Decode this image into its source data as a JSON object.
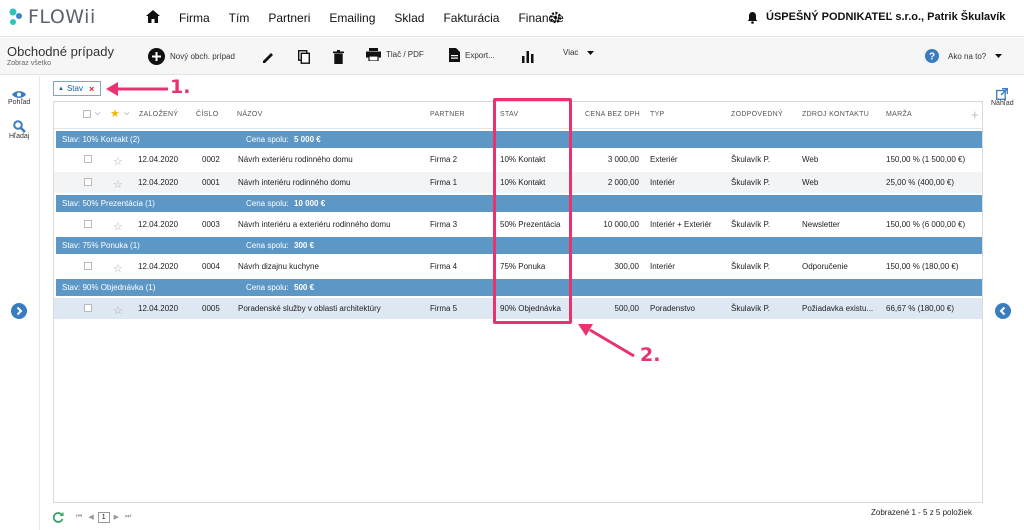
{
  "app": {
    "logo_text": "FLOWii"
  },
  "nav": {
    "menu": [
      "Firma",
      "Tím",
      "Partneri",
      "Emailing",
      "Sklad",
      "Fakturácia",
      "Financie"
    ],
    "company": "ÚSPEŠNÝ PODNIKATEĽ s.r.o., Patrik Škulavík"
  },
  "toolbar": {
    "title": "Obchodné prípady",
    "subtitle": "Zobraz všetko",
    "new_label": "Nový obch. prípad",
    "print_label": "Tlač / PDF",
    "export_label": "Export...",
    "more_label": "Viac",
    "help_label": "Ako na to?"
  },
  "side": {
    "view_label": "Pohľad",
    "search_label": "Hľadaj",
    "preview_label": "Náhľad"
  },
  "filter_chip": {
    "label": "Stav"
  },
  "grid": {
    "headers": [
      "ZALOŽENÝ",
      "ČÍSLO",
      "NÁZOV",
      "PARTNER",
      "STAV",
      "CENA BEZ DPH",
      "TYP",
      "ZODPOVEDNÝ",
      "ZDROJ KONTAKTU",
      "MARŽA"
    ],
    "groups": [
      {
        "title": "Stav: 10% Kontakt (2)",
        "total_label": "Cena spolu:",
        "total": "5 000 €",
        "rows": [
          {
            "date": "12.04.2020",
            "num": "0002",
            "name": "Návrh exteriéru rodinného domu",
            "partner": "Firma 2",
            "status": "10% Kontakt",
            "price": "3 000,00",
            "type": "Exteriér",
            "owner": "Škulavík P.",
            "source": "Web",
            "margin": "150,00 % (1 500,00 €)"
          },
          {
            "date": "12.04.2020",
            "num": "0001",
            "name": "Návrh interiéru rodinného domu",
            "partner": "Firma 1",
            "status": "10% Kontakt",
            "price": "2 000,00",
            "type": "Interiér",
            "owner": "Škulavík P.",
            "source": "Web",
            "margin": "25,00 % (400,00 €)"
          }
        ]
      },
      {
        "title": "Stav: 50% Prezentácia (1)",
        "total_label": "Cena spolu:",
        "total": "10 000 €",
        "rows": [
          {
            "date": "12.04.2020",
            "num": "0003",
            "name": "Návrh interiéru a exteriéru rodinného domu",
            "partner": "Firma 3",
            "status": "50% Prezentácia",
            "price": "10 000,00",
            "type": "Interiér + Exteriér",
            "owner": "Škulavík P.",
            "source": "Newsletter",
            "margin": "150,00 % (6 000,00 €)"
          }
        ]
      },
      {
        "title": "Stav: 75% Ponuka (1)",
        "total_label": "Cena spolu:",
        "total": "300 €",
        "rows": [
          {
            "date": "12.04.2020",
            "num": "0004",
            "name": "Návrh dizajnu kuchyne",
            "partner": "Firma 4",
            "status": "75% Ponuka",
            "price": "300,00",
            "type": "Interiér",
            "owner": "Škulavík P.",
            "source": "Odporučenie",
            "margin": "150,00 % (180,00 €)"
          }
        ]
      },
      {
        "title": "Stav: 90% Objednávka (1)",
        "total_label": "Cena spolu:",
        "total": "500 €",
        "rows": [
          {
            "date": "12.04.2020",
            "num": "0005",
            "name": "Poradenské služby v oblasti architektúry",
            "partner": "Firma 5",
            "status": "90% Objednávka",
            "price": "500,00",
            "type": "Poradenstvo",
            "owner": "Škulavík P.",
            "source": "Požiadavka existu...",
            "margin": "66,67 % (180,00 €)"
          }
        ]
      }
    ]
  },
  "pager": {
    "page": "1"
  },
  "summary": "Zobrazené 1 - 5 z 5 položiek",
  "annotations": {
    "label1": "1.",
    "label2": "2."
  },
  "colors": {
    "accent": "#e8336e",
    "group_bg": "#5d97c6",
    "chip_border": "#7fa6c9"
  }
}
